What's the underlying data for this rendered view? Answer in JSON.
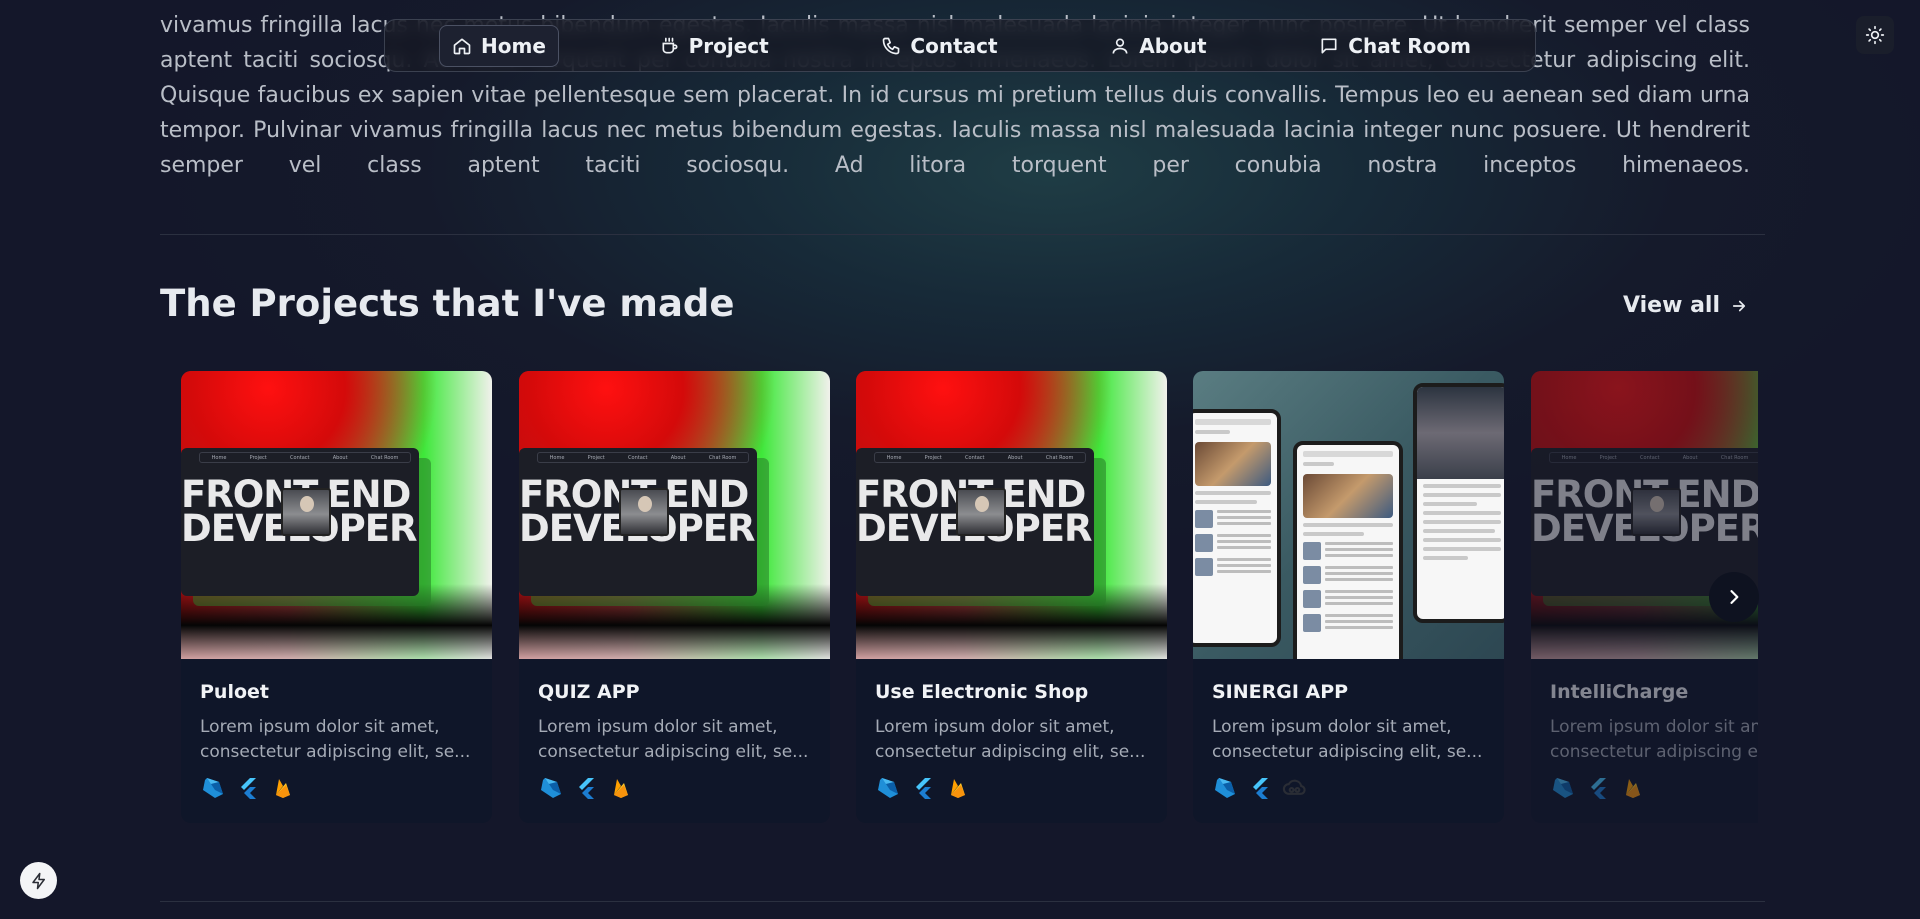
{
  "intro": {
    "lines": [
      "vivamus fringilla lacus nec metus bibendum egestas. Iaculis massa nisl malesuada lacinia integer nunc posuere. Ut hendrerit semper vel class",
      "aptent taciti sociosqu. Ad litora torquent per conubia nostra inceptos himenaeos. Lorem ipsum dolor sit amet, consectetur adipiscing elit.",
      "Quisque faucibus ex sapien vitae pellentesque sem placerat. In id cursus mi pretium tellus duis convallis. Tempus leo eu aenean sed diam urna",
      "tempor. Pulvinar vivamus fringilla lacus nec metus bibendum egestas. Iaculis massa nisl malesuada lacinia integer nunc posuere. Ut hendrerit",
      "semper vel class aptent taciti sociosqu. Ad litora torquent per conubia nostra inceptos himenaeos."
    ]
  },
  "nav": {
    "items": [
      {
        "label": "Home",
        "icon": "home-icon",
        "active": true
      },
      {
        "label": "Project",
        "icon": "coffee-icon",
        "active": false
      },
      {
        "label": "Contact",
        "icon": "phone-icon",
        "active": false
      },
      {
        "label": "About",
        "icon": "user-icon",
        "active": false
      },
      {
        "label": "Chat Room",
        "icon": "chat-icon",
        "active": false
      }
    ]
  },
  "theme_toggle": {
    "icon": "sun-icon"
  },
  "projects": {
    "title": "The Projects that I've made",
    "view_all": "View all",
    "cards": [
      {
        "title": "Puloet",
        "desc": "Lorem ipsum dolor sit amet, consectetur adipiscing elit, se...",
        "thumb_text": "FRONT-END\nDEVELOPER",
        "tech": [
          "dart-icon",
          "flutter-icon",
          "firebase-icon"
        ]
      },
      {
        "title": "QUIZ APP",
        "desc": "Lorem ipsum dolor sit amet, consectetur adipiscing elit, se...",
        "thumb_text": "FRONT-END\nDEVELOPER",
        "tech": [
          "dart-icon",
          "flutter-icon",
          "firebase-icon"
        ]
      },
      {
        "title": "Use Electronic Shop",
        "desc": "Lorem ipsum dolor sit amet, consectetur adipiscing elit, se...",
        "thumb_text": "FRONT-END\nDEVELOPER",
        "tech": [
          "dart-icon",
          "flutter-icon",
          "firebase-icon"
        ]
      },
      {
        "title": "SINERGI APP",
        "desc": "Lorem ipsum dolor sit amet, consectetur adipiscing elit, se...",
        "thumb_text": "",
        "tech": [
          "dart-icon",
          "flutter-icon",
          "cloud-icon"
        ]
      },
      {
        "title": "IntelliCharge",
        "desc": "Lorem ipsum dolor sit amet, consectetur adipiscing elit, se...",
        "thumb_text": "FRONT-END\nDEVELOPER",
        "tech": [
          "dart-icon",
          "flutter-icon",
          "firebase-icon"
        ]
      }
    ],
    "mini_nav": [
      "Home",
      "Project",
      "Contact",
      "About",
      "Chat Room"
    ]
  },
  "colors": {
    "accent": "#e7eaef",
    "card_bg": "#0f1629",
    "page_bg": "#14172a"
  }
}
